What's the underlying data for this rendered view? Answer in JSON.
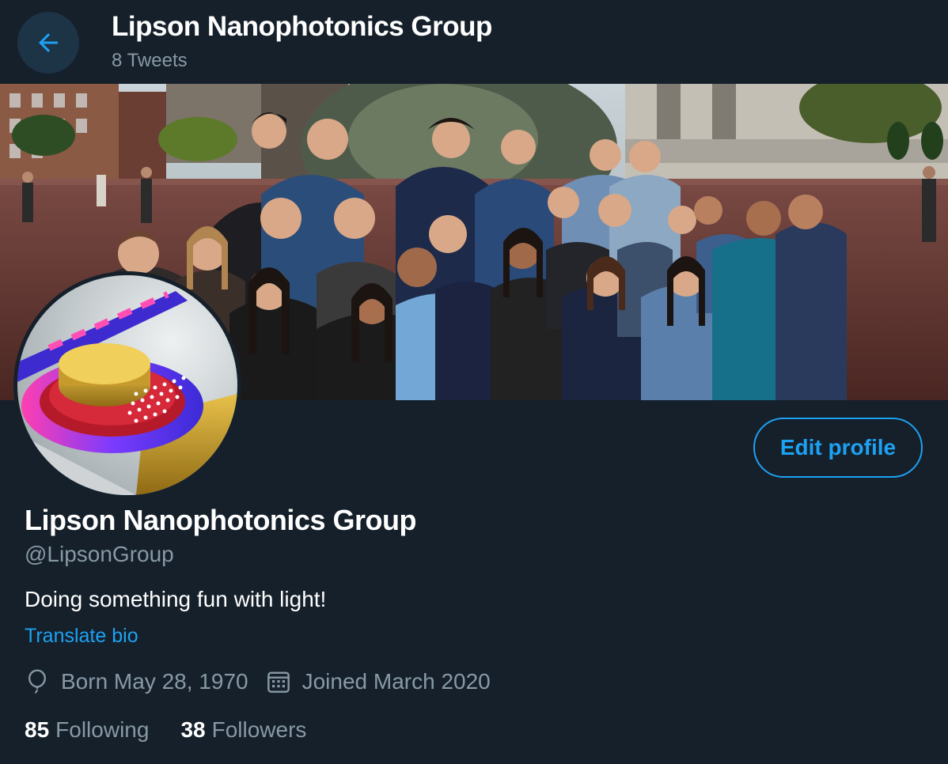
{
  "header": {
    "back_icon": "arrow-left-icon",
    "title": "Lipson Nanophotonics Group",
    "tweet_count": "8 Tweets"
  },
  "banner": {
    "description_icon": "group-photo"
  },
  "avatar": {
    "icon": "nanophotonic-ring-resonator-image"
  },
  "actions": {
    "edit_profile_label": "Edit profile"
  },
  "profile": {
    "name": "Lipson Nanophotonics Group",
    "handle": "@LipsonGroup",
    "bio": "Doing something fun with light!",
    "translate_label": "Translate bio",
    "born": "Born May 28, 1970",
    "born_icon": "balloon-icon",
    "joined": "Joined March 2020",
    "joined_icon": "calendar-icon",
    "following_count": "85",
    "following_label": "Following",
    "followers_count": "38",
    "followers_label": "Followers"
  },
  "colors": {
    "background": "#15202b",
    "accent": "#1da1f2",
    "secondary_text": "#8899a6",
    "back_button_bg": "#1d3346"
  }
}
